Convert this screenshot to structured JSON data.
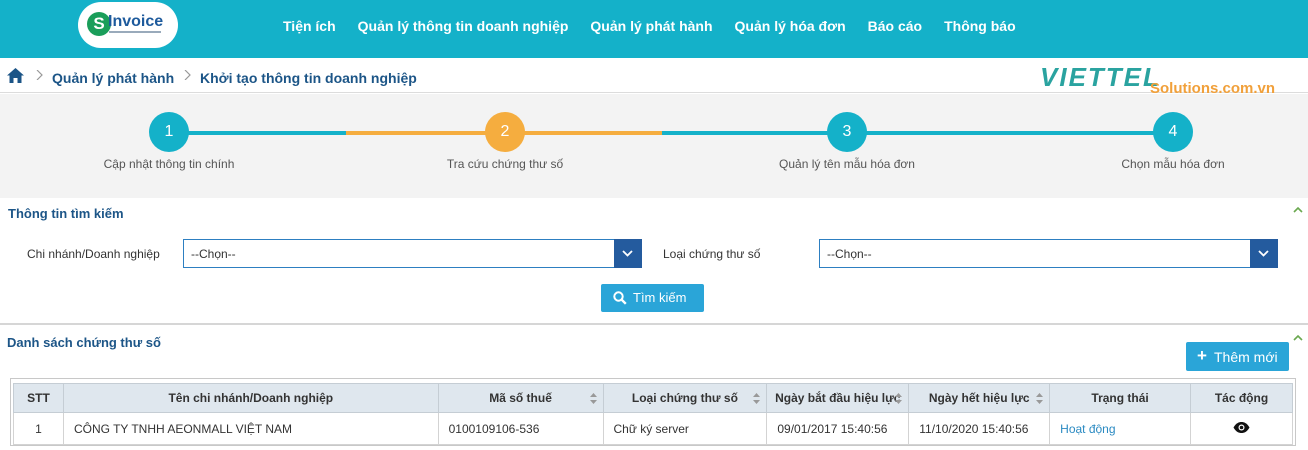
{
  "nav": {
    "logo_letter": "S",
    "logo_text": "Invoice",
    "items": [
      "Tiện ích",
      "Quản lý thông tin doanh nghiệp",
      "Quản lý phát hành",
      "Quản lý hóa đơn",
      "Báo cáo",
      "Thông báo"
    ]
  },
  "breadcrumb": {
    "items": [
      "Quản lý phát hành",
      "Khởi tạo thông tin doanh nghiệp"
    ]
  },
  "brand": {
    "name": "VIETTEL",
    "tagline": "Solutions.com.vn"
  },
  "steps": [
    {
      "number": "1",
      "label": "Cập nhật thông tin chính",
      "state": "done"
    },
    {
      "number": "2",
      "label": "Tra cứu chứng thư số",
      "state": "active"
    },
    {
      "number": "3",
      "label": "Quản lý tên mẫu hóa đơn",
      "state": "pending"
    },
    {
      "number": "4",
      "label": "Chọn mẫu hóa đơn",
      "state": "pending"
    }
  ],
  "search_panel": {
    "title": "Thông tin tìm kiếm",
    "branch_label": "Chi nhánh/Doanh nghiệp",
    "branch_value": "--Chọn--",
    "cert_type_label": "Loại chứng thư số",
    "cert_type_value": "--Chọn--",
    "search_button": "Tìm kiếm"
  },
  "list_panel": {
    "title": "Danh sách chứng thư số",
    "add_button": "Thêm mới",
    "columns": [
      "STT",
      "Tên chi nhánh/Doanh nghiệp",
      "Mã số thuế",
      "Loại chứng thư số",
      "Ngày bắt đầu hiệu lực",
      "Ngày hết hiệu lực",
      "Trạng thái",
      "Tác động"
    ],
    "rows": [
      {
        "stt": "1",
        "name": "CÔNG TY TNHH AEONMALL VIỆT NAM",
        "tax_code": "0100109106-536",
        "cert_type": "Chữ ký server",
        "start_date": "09/01/2017 15:40:56",
        "end_date": "11/10/2020 15:40:56",
        "status": "Hoạt động",
        "action_icon": "eye-icon"
      }
    ]
  },
  "colors": {
    "topbar": "#14b1c9",
    "step_done": "#14b1c9",
    "step_active": "#f5ad3f",
    "title_blue": "#1c5587",
    "button_blue": "#2aa5d8"
  }
}
